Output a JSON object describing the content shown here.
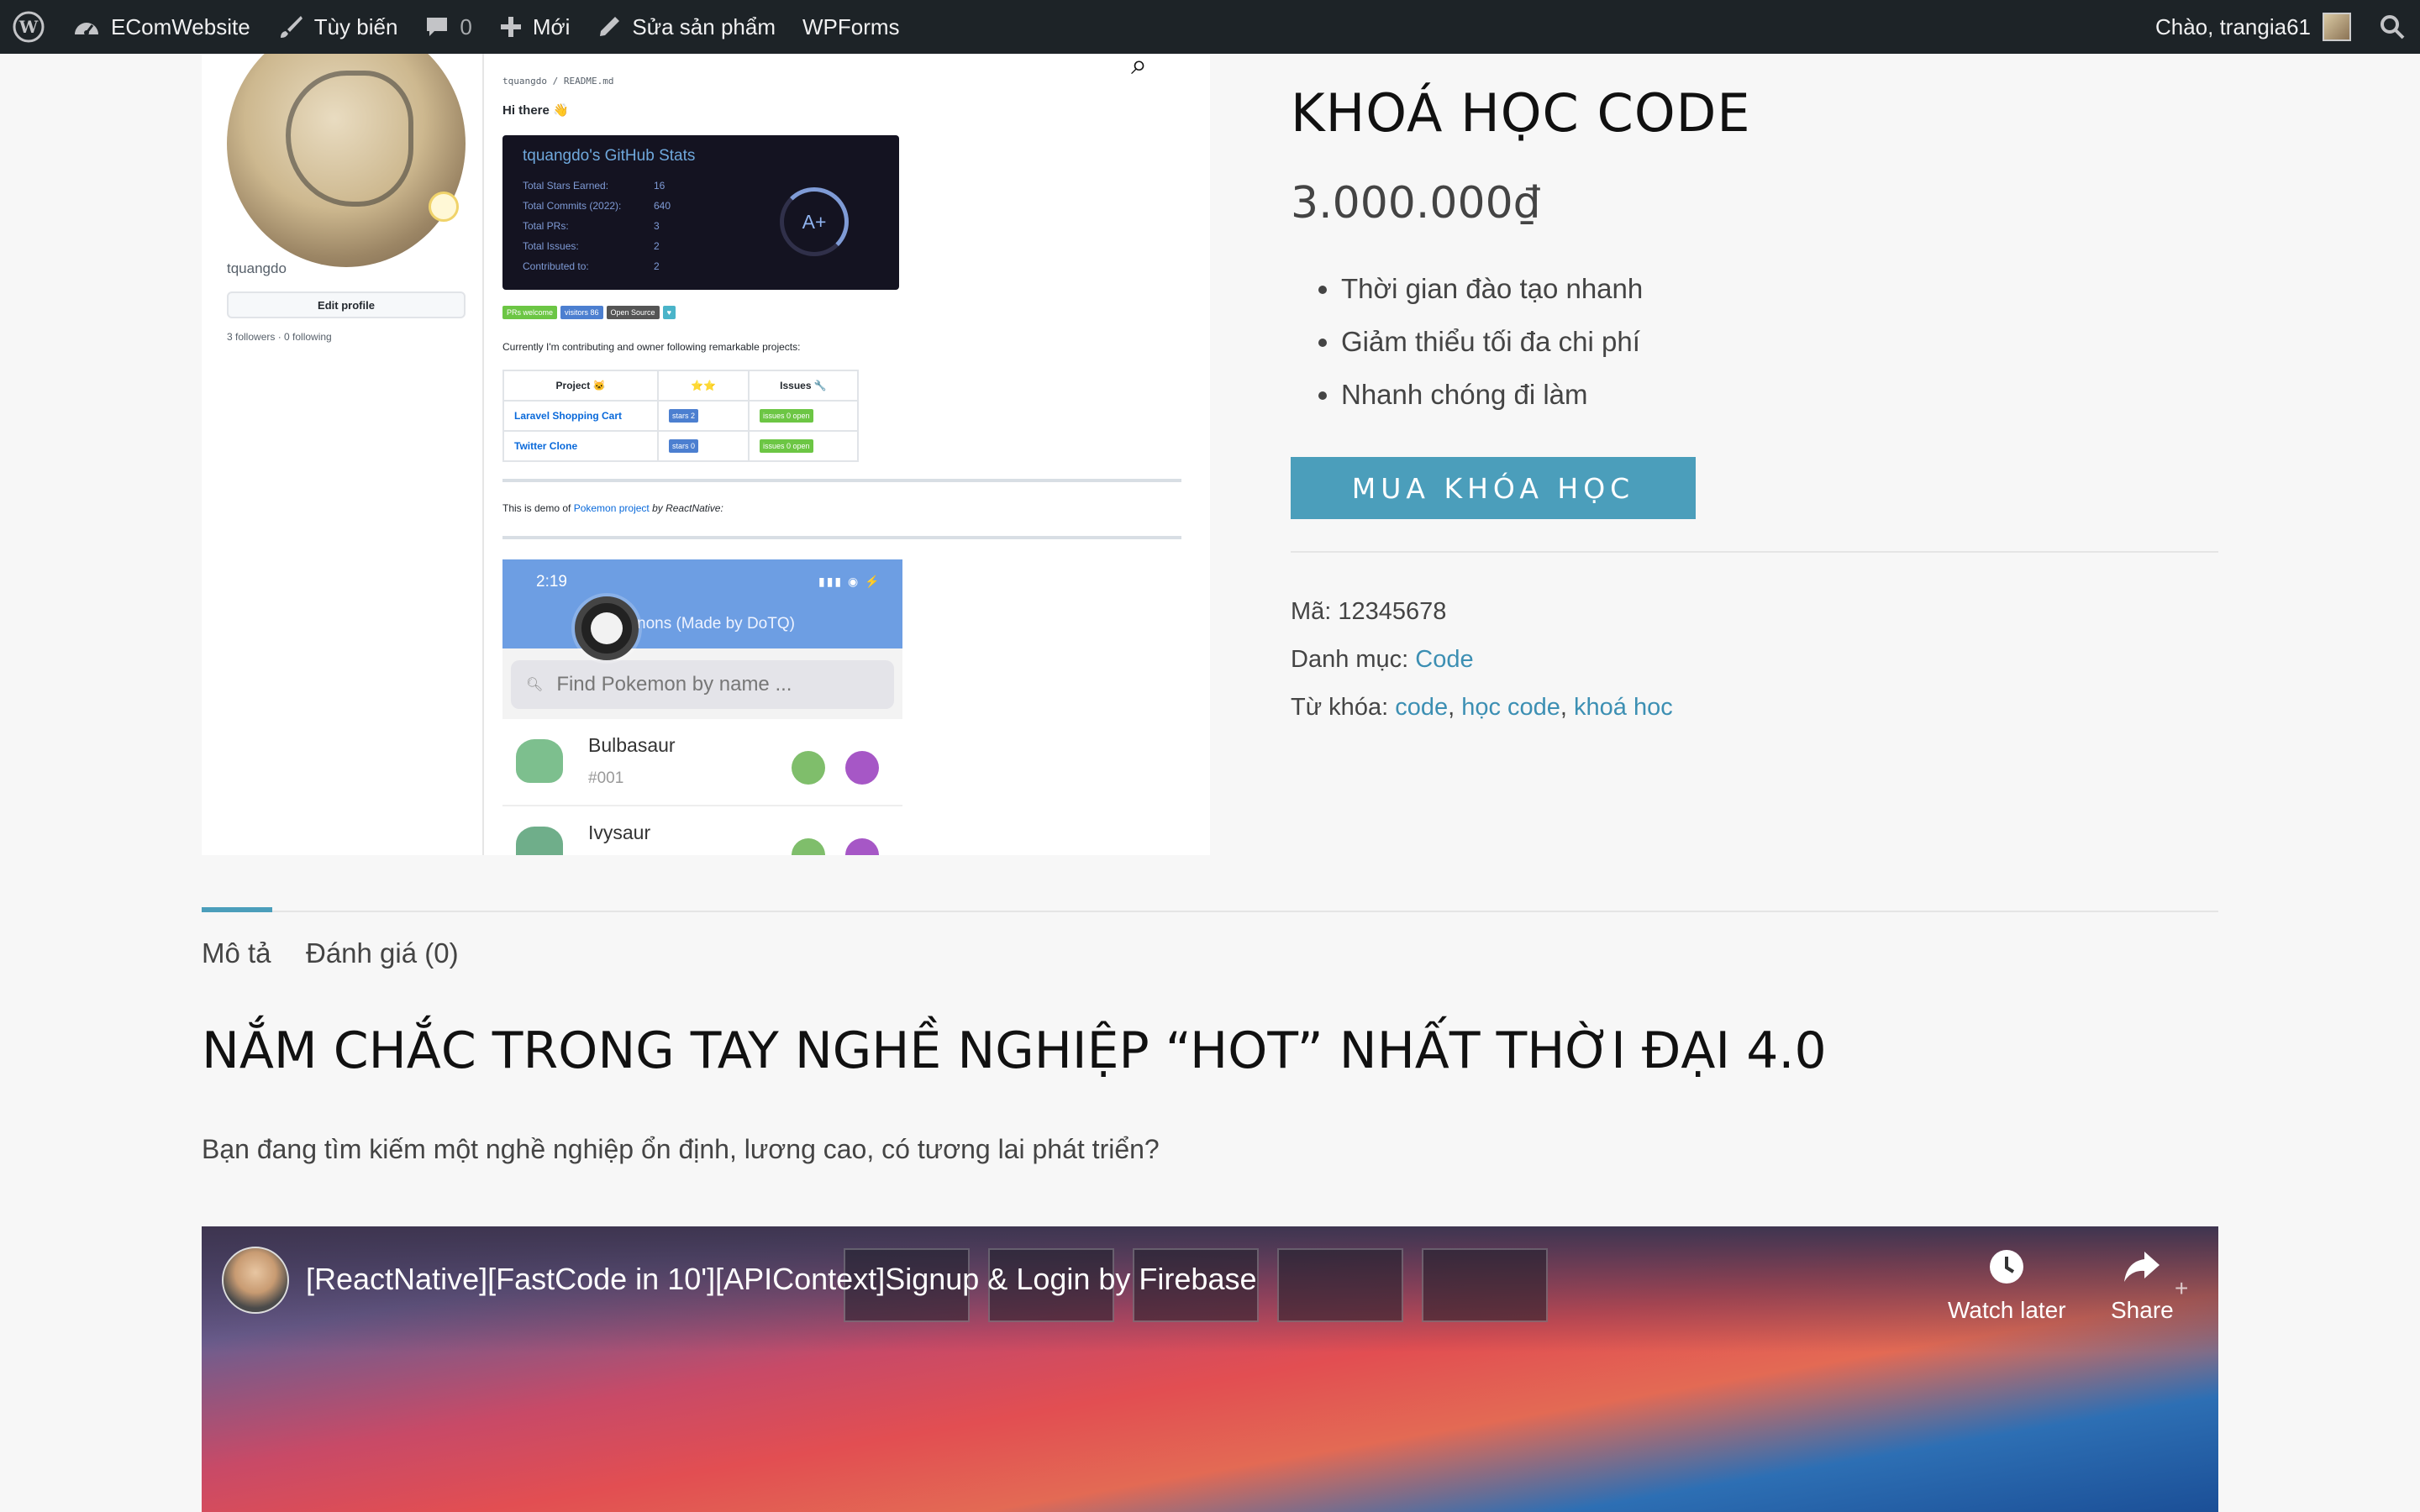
{
  "adminbar": {
    "site_name": "EComWebsite",
    "customize": "Tùy biến",
    "comments_count": "0",
    "new": "Mới",
    "edit_product": "Sửa sản phẩm",
    "wpforms": "WPForms",
    "greeting": "Chào, trangia61"
  },
  "gallery": {
    "username": "tquangdo",
    "edit_profile": "Edit profile",
    "followers": "3 followers · 0 following",
    "path": "tquangdo / README.md",
    "hi": "Hi there 👋",
    "stats_title": "tquangdo's GitHub Stats",
    "stats": [
      {
        "label": "Total Stars Earned:",
        "value": "16"
      },
      {
        "label": "Total Commits (2022):",
        "value": "640"
      },
      {
        "label": "Total PRs:",
        "value": "3"
      },
      {
        "label": "Total Issues:",
        "value": "2"
      },
      {
        "label": "Contributed to:",
        "value": "2"
      }
    ],
    "grade": "A+",
    "badges": [
      "PRs welcome",
      "visitors 86",
      "Open Source",
      "♥"
    ],
    "currently": "Currently I'm contributing and owner following remarkable projects:",
    "table_headers": [
      "Project 🐱",
      "⭐⭐",
      "Issues 🔧"
    ],
    "table_rows": [
      {
        "project": "Laravel Shopping Cart",
        "stars": "stars 2",
        "issues": "issues 0 open"
      },
      {
        "project": "Twitter Clone",
        "stars": "stars 0",
        "issues": "issues 0 open"
      }
    ],
    "demo_prefix": "This is demo of ",
    "demo_link": "Pokemon project",
    "demo_suffix": " by ReactNative:",
    "phone_time": "2:19",
    "phone_title": "nons (Made by DoTQ)",
    "phone_search_placeholder": "Find Pokemon by name ...",
    "pokemon": [
      {
        "name": "Bulbasaur",
        "num": "#001"
      },
      {
        "name": "Ivysaur",
        "num": ""
      }
    ]
  },
  "product": {
    "title": "KHOÁ HỌC CODE",
    "price": "3.000.000₫",
    "features": [
      "Thời gian đào tạo nhanh",
      "Giảm thiểu tối đa chi phí",
      "Nhanh chóng đi làm"
    ],
    "buy_button": "MUA KHÓA HỌC",
    "sku_label": "Mã: ",
    "sku": "12345678",
    "category_label": "Danh mục: ",
    "category": "Code",
    "tags_label": "Từ khóa: ",
    "tags": [
      "code",
      "học code",
      "khoá hoc"
    ]
  },
  "tabs": {
    "description": "Mô tả",
    "reviews": "Đánh giá (0)"
  },
  "description": {
    "heading": "NẮM CHẮC TRONG TAY NGHỀ NGHIỆP “HOT” NHẤT THỜI ĐẠI 4.0",
    "text": "Bạn đang tìm kiếm một nghề nghiệp ổn định, lương cao, có tương lai phát triển?"
  },
  "video": {
    "title": "[ReactNative][FastCode in 10'][APIContext]Signup & Login by Firebase",
    "watch_later": "Watch later",
    "share": "Share"
  },
  "colors": {
    "adminbar": "#1d2327",
    "accent": "#4b9ebb",
    "link": "#3c8fb3"
  }
}
